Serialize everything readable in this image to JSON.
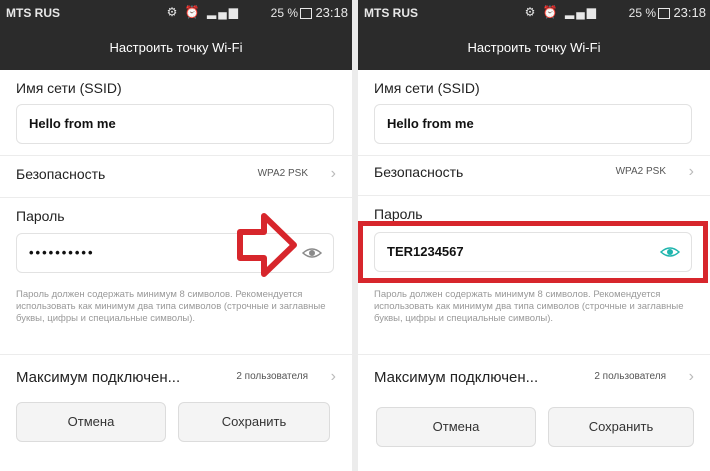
{
  "colors": {
    "bar": "#2b2b2b",
    "accent": "#d7262c",
    "eye_left": "#8a8a8a",
    "eye_right": "#1fb5ad"
  },
  "status_bar": {
    "carrier": "MTS RUS",
    "battery": "25 %",
    "time": "23:18"
  },
  "screen": {
    "title": "Настроить точку Wi-Fi",
    "ssid_label": "Имя сети (SSID)",
    "ssid_value": "Hello from me",
    "security_label": "Безопасность",
    "security_value": "WPA2 PSK",
    "password_label": "Пароль",
    "password_hint": "Пароль должен содержать минимум 8 символов. Рекомендуется использовать как минимум два типа символов (строчные и заглавные буквы, цифры и специальные символы).",
    "max_label": "Максимум подключен...",
    "max_value": "2 пользователя",
    "cancel": "Отмена",
    "save": "Сохранить"
  },
  "left": {
    "password_value": "••••••••••"
  },
  "right": {
    "password_value": "TER1234567"
  },
  "icons": {
    "eye": "eye-icon",
    "chevron": "chevron-right-icon",
    "arrow": "arrow-right-icon"
  }
}
